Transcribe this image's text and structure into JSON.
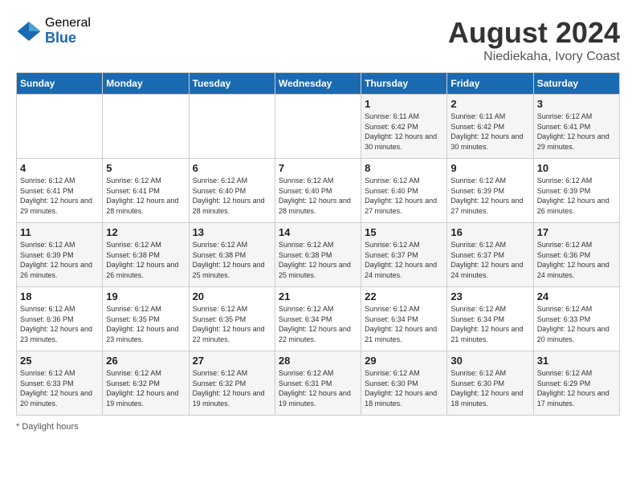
{
  "logo": {
    "general": "General",
    "blue": "Blue"
  },
  "title": "August 2024",
  "subtitle": "Niediekaha, Ivory Coast",
  "days_of_week": [
    "Sunday",
    "Monday",
    "Tuesday",
    "Wednesday",
    "Thursday",
    "Friday",
    "Saturday"
  ],
  "weeks": [
    [
      {
        "num": "",
        "detail": ""
      },
      {
        "num": "",
        "detail": ""
      },
      {
        "num": "",
        "detail": ""
      },
      {
        "num": "",
        "detail": ""
      },
      {
        "num": "1",
        "detail": "Sunrise: 6:11 AM\nSunset: 6:42 PM\nDaylight: 12 hours\nand 30 minutes."
      },
      {
        "num": "2",
        "detail": "Sunrise: 6:11 AM\nSunset: 6:42 PM\nDaylight: 12 hours\nand 30 minutes."
      },
      {
        "num": "3",
        "detail": "Sunrise: 6:12 AM\nSunset: 6:41 PM\nDaylight: 12 hours\nand 29 minutes."
      }
    ],
    [
      {
        "num": "4",
        "detail": "Sunrise: 6:12 AM\nSunset: 6:41 PM\nDaylight: 12 hours\nand 29 minutes."
      },
      {
        "num": "5",
        "detail": "Sunrise: 6:12 AM\nSunset: 6:41 PM\nDaylight: 12 hours\nand 28 minutes."
      },
      {
        "num": "6",
        "detail": "Sunrise: 6:12 AM\nSunset: 6:40 PM\nDaylight: 12 hours\nand 28 minutes."
      },
      {
        "num": "7",
        "detail": "Sunrise: 6:12 AM\nSunset: 6:40 PM\nDaylight: 12 hours\nand 28 minutes."
      },
      {
        "num": "8",
        "detail": "Sunrise: 6:12 AM\nSunset: 6:40 PM\nDaylight: 12 hours\nand 27 minutes."
      },
      {
        "num": "9",
        "detail": "Sunrise: 6:12 AM\nSunset: 6:39 PM\nDaylight: 12 hours\nand 27 minutes."
      },
      {
        "num": "10",
        "detail": "Sunrise: 6:12 AM\nSunset: 6:39 PM\nDaylight: 12 hours\nand 26 minutes."
      }
    ],
    [
      {
        "num": "11",
        "detail": "Sunrise: 6:12 AM\nSunset: 6:39 PM\nDaylight: 12 hours\nand 26 minutes."
      },
      {
        "num": "12",
        "detail": "Sunrise: 6:12 AM\nSunset: 6:38 PM\nDaylight: 12 hours\nand 26 minutes."
      },
      {
        "num": "13",
        "detail": "Sunrise: 6:12 AM\nSunset: 6:38 PM\nDaylight: 12 hours\nand 25 minutes."
      },
      {
        "num": "14",
        "detail": "Sunrise: 6:12 AM\nSunset: 6:38 PM\nDaylight: 12 hours\nand 25 minutes."
      },
      {
        "num": "15",
        "detail": "Sunrise: 6:12 AM\nSunset: 6:37 PM\nDaylight: 12 hours\nand 24 minutes."
      },
      {
        "num": "16",
        "detail": "Sunrise: 6:12 AM\nSunset: 6:37 PM\nDaylight: 12 hours\nand 24 minutes."
      },
      {
        "num": "17",
        "detail": "Sunrise: 6:12 AM\nSunset: 6:36 PM\nDaylight: 12 hours\nand 24 minutes."
      }
    ],
    [
      {
        "num": "18",
        "detail": "Sunrise: 6:12 AM\nSunset: 6:36 PM\nDaylight: 12 hours\nand 23 minutes."
      },
      {
        "num": "19",
        "detail": "Sunrise: 6:12 AM\nSunset: 6:35 PM\nDaylight: 12 hours\nand 23 minutes."
      },
      {
        "num": "20",
        "detail": "Sunrise: 6:12 AM\nSunset: 6:35 PM\nDaylight: 12 hours\nand 22 minutes."
      },
      {
        "num": "21",
        "detail": "Sunrise: 6:12 AM\nSunset: 6:34 PM\nDaylight: 12 hours\nand 22 minutes."
      },
      {
        "num": "22",
        "detail": "Sunrise: 6:12 AM\nSunset: 6:34 PM\nDaylight: 12 hours\nand 21 minutes."
      },
      {
        "num": "23",
        "detail": "Sunrise: 6:12 AM\nSunset: 6:34 PM\nDaylight: 12 hours\nand 21 minutes."
      },
      {
        "num": "24",
        "detail": "Sunrise: 6:12 AM\nSunset: 6:33 PM\nDaylight: 12 hours\nand 20 minutes."
      }
    ],
    [
      {
        "num": "25",
        "detail": "Sunrise: 6:12 AM\nSunset: 6:33 PM\nDaylight: 12 hours\nand 20 minutes."
      },
      {
        "num": "26",
        "detail": "Sunrise: 6:12 AM\nSunset: 6:32 PM\nDaylight: 12 hours\nand 19 minutes."
      },
      {
        "num": "27",
        "detail": "Sunrise: 6:12 AM\nSunset: 6:32 PM\nDaylight: 12 hours\nand 19 minutes."
      },
      {
        "num": "28",
        "detail": "Sunrise: 6:12 AM\nSunset: 6:31 PM\nDaylight: 12 hours\nand 19 minutes."
      },
      {
        "num": "29",
        "detail": "Sunrise: 6:12 AM\nSunset: 6:30 PM\nDaylight: 12 hours\nand 18 minutes."
      },
      {
        "num": "30",
        "detail": "Sunrise: 6:12 AM\nSunset: 6:30 PM\nDaylight: 12 hours\nand 18 minutes."
      },
      {
        "num": "31",
        "detail": "Sunrise: 6:12 AM\nSunset: 6:29 PM\nDaylight: 12 hours\nand 17 minutes."
      }
    ]
  ],
  "footer": "Daylight hours"
}
